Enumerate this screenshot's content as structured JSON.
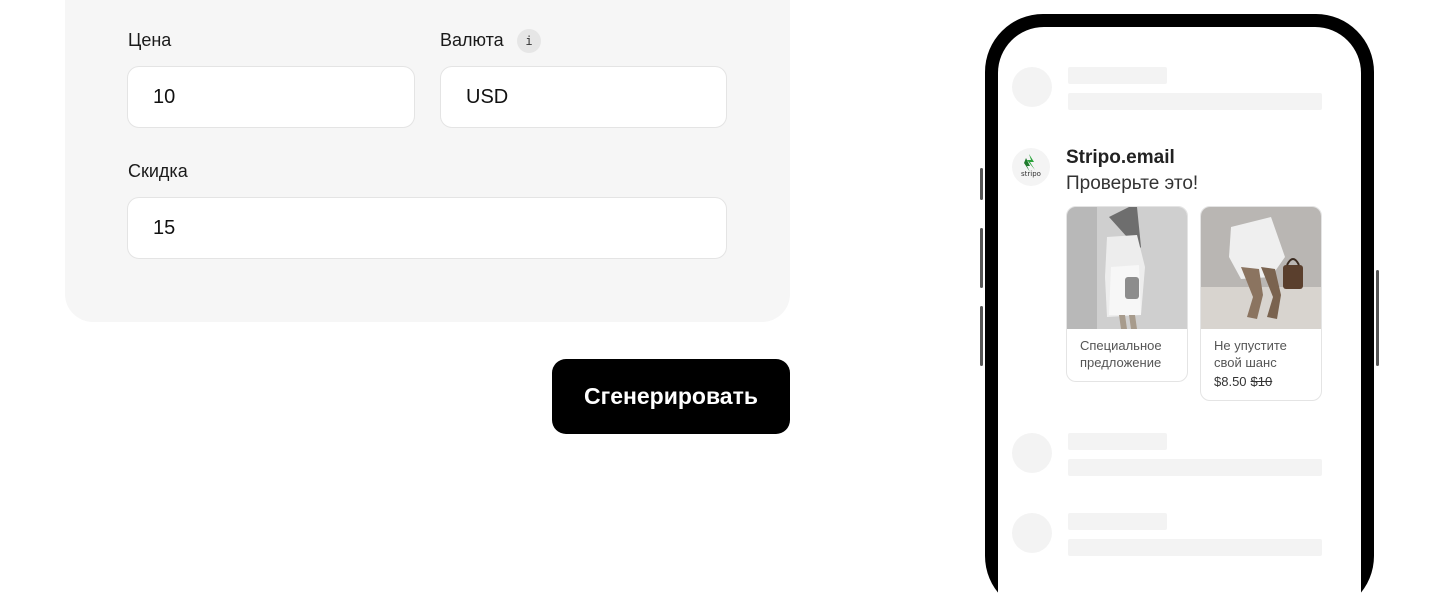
{
  "form": {
    "price_label": "Цена",
    "price_value": "10",
    "currency_label": "Валюта",
    "currency_info": "i",
    "currency_value": "USD",
    "discount_label": "Скидка",
    "discount_value": "15",
    "generate_label": "Сгенерировать"
  },
  "preview": {
    "sender": "Stripo.email",
    "message": "Проверьте это!",
    "logo_text": "stripo",
    "cards": [
      {
        "title": "Специальное предложение"
      },
      {
        "title": "Не упустите свой шанс",
        "price": "$8.50",
        "old_price": "$10"
      }
    ]
  }
}
